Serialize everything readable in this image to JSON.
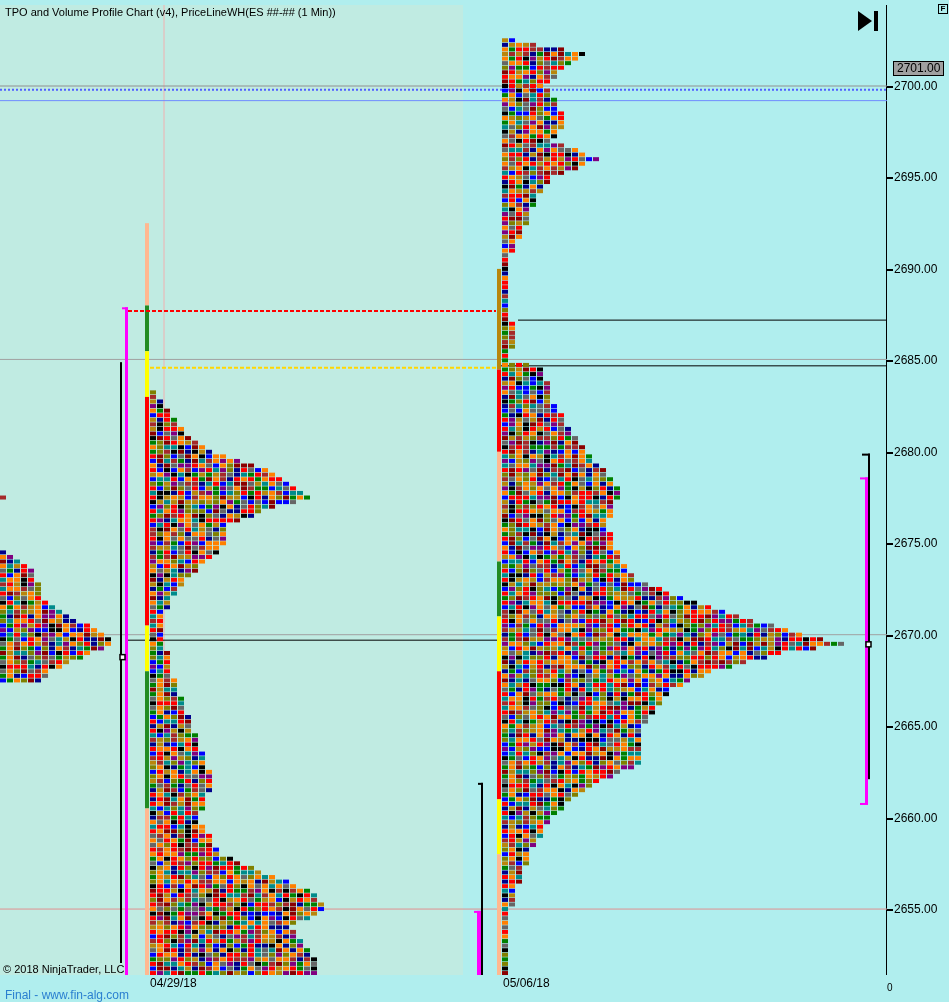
{
  "chart_title": "TPO and Volume Profile Chart (v4), PriceLineWH(ES ##-## (1 Min))",
  "corner_button": "F",
  "price_axis": {
    "current_price": "2701.00",
    "ticks": [
      "2700.00",
      "2695.00",
      "2690.00",
      "2685.00",
      "2680.00",
      "2675.00",
      "2670.00",
      "2665.00",
      "2660.00",
      "2655.00"
    ]
  },
  "copyright": "© 2018 NinjaTrader, LLC",
  "date_labels": [
    "04/29/18",
    "05/06/18"
  ],
  "footer_link": "Final - www.fin-alg.com",
  "axis_corner_label": "0"
}
